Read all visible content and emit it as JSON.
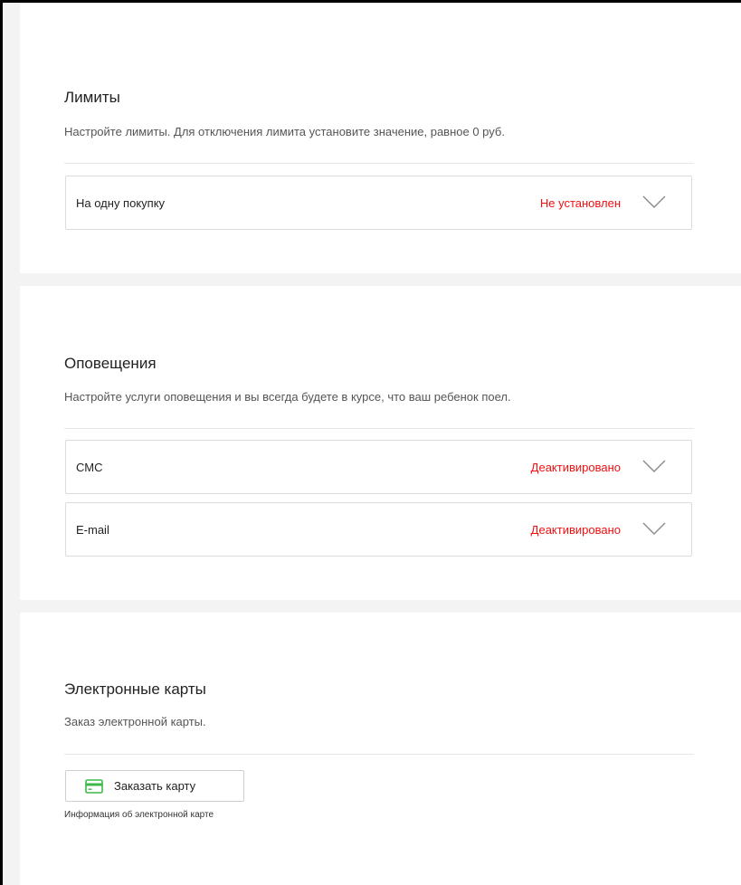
{
  "limits": {
    "title": "Лимиты",
    "description": "Настройте лимиты. Для отключения лимита установите значение, равное 0 руб.",
    "items": [
      {
        "label": "На одну покупку",
        "status": "Не установлен",
        "icon": "chevron-down-icon"
      }
    ]
  },
  "notifications": {
    "title": "Оповещения",
    "description": "Настройте услуги оповещения и вы всегда будете в курсе, что ваш ребенок поел.",
    "items": [
      {
        "label": "СМС",
        "status": "Деактивировано",
        "icon": "chevron-down-icon"
      },
      {
        "label": "E-mail",
        "status": "Деактивировано",
        "icon": "chevron-down-icon"
      }
    ]
  },
  "cards": {
    "title": "Электронные карты",
    "description": "Заказ электронной карты.",
    "order_button": {
      "label": "Заказать карту",
      "icon": "credit-card-icon"
    },
    "info_link": "Информация об электронной карте"
  },
  "colors": {
    "status_red": "#ee1111",
    "card_icon_green": "#3fb84a",
    "page_background": "#f3f3f3"
  }
}
